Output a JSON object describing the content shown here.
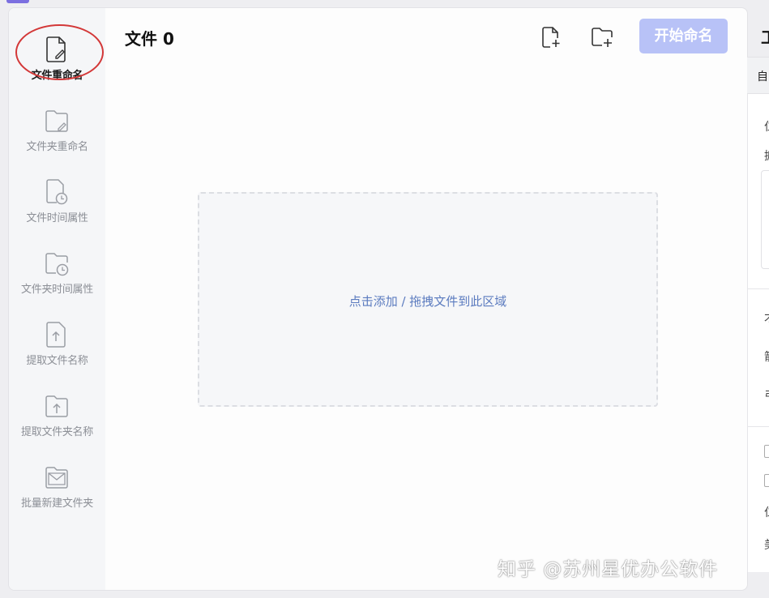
{
  "header": {
    "title": "文件 0",
    "add_file_icon": "file-plus-icon",
    "add_folder_icon": "folder-plus-icon",
    "start_label": "开始命名"
  },
  "sidebar": {
    "items": [
      {
        "label": "文件重命名",
        "icon": "file-edit-icon",
        "active": true
      },
      {
        "label": "文件夹重命名",
        "icon": "folder-edit-icon"
      },
      {
        "label": "文件时间属性",
        "icon": "file-clock-icon"
      },
      {
        "label": "文件夹时间属性",
        "icon": "folder-clock-icon"
      },
      {
        "label": "提取文件名称",
        "icon": "file-upload-icon"
      },
      {
        "label": "提取文件夹名称",
        "icon": "folder-upload-icon"
      },
      {
        "label": "批量新建文件夹",
        "icon": "folder-mail-icon"
      }
    ]
  },
  "dropzone": {
    "text": "点击添加 / 拖拽文件到此区域"
  },
  "right_panel": {
    "title": "工",
    "tab": "自",
    "labels": [
      "仁",
      "搪",
      "才",
      "箭",
      "弓",
      "仁",
      "美"
    ]
  },
  "watermark": "知乎 @苏州星优办公软件",
  "colors": {
    "accent_disabled": "#b8c2f7",
    "link_text": "#5b7bbf",
    "annotation_ring": "#d33838"
  }
}
